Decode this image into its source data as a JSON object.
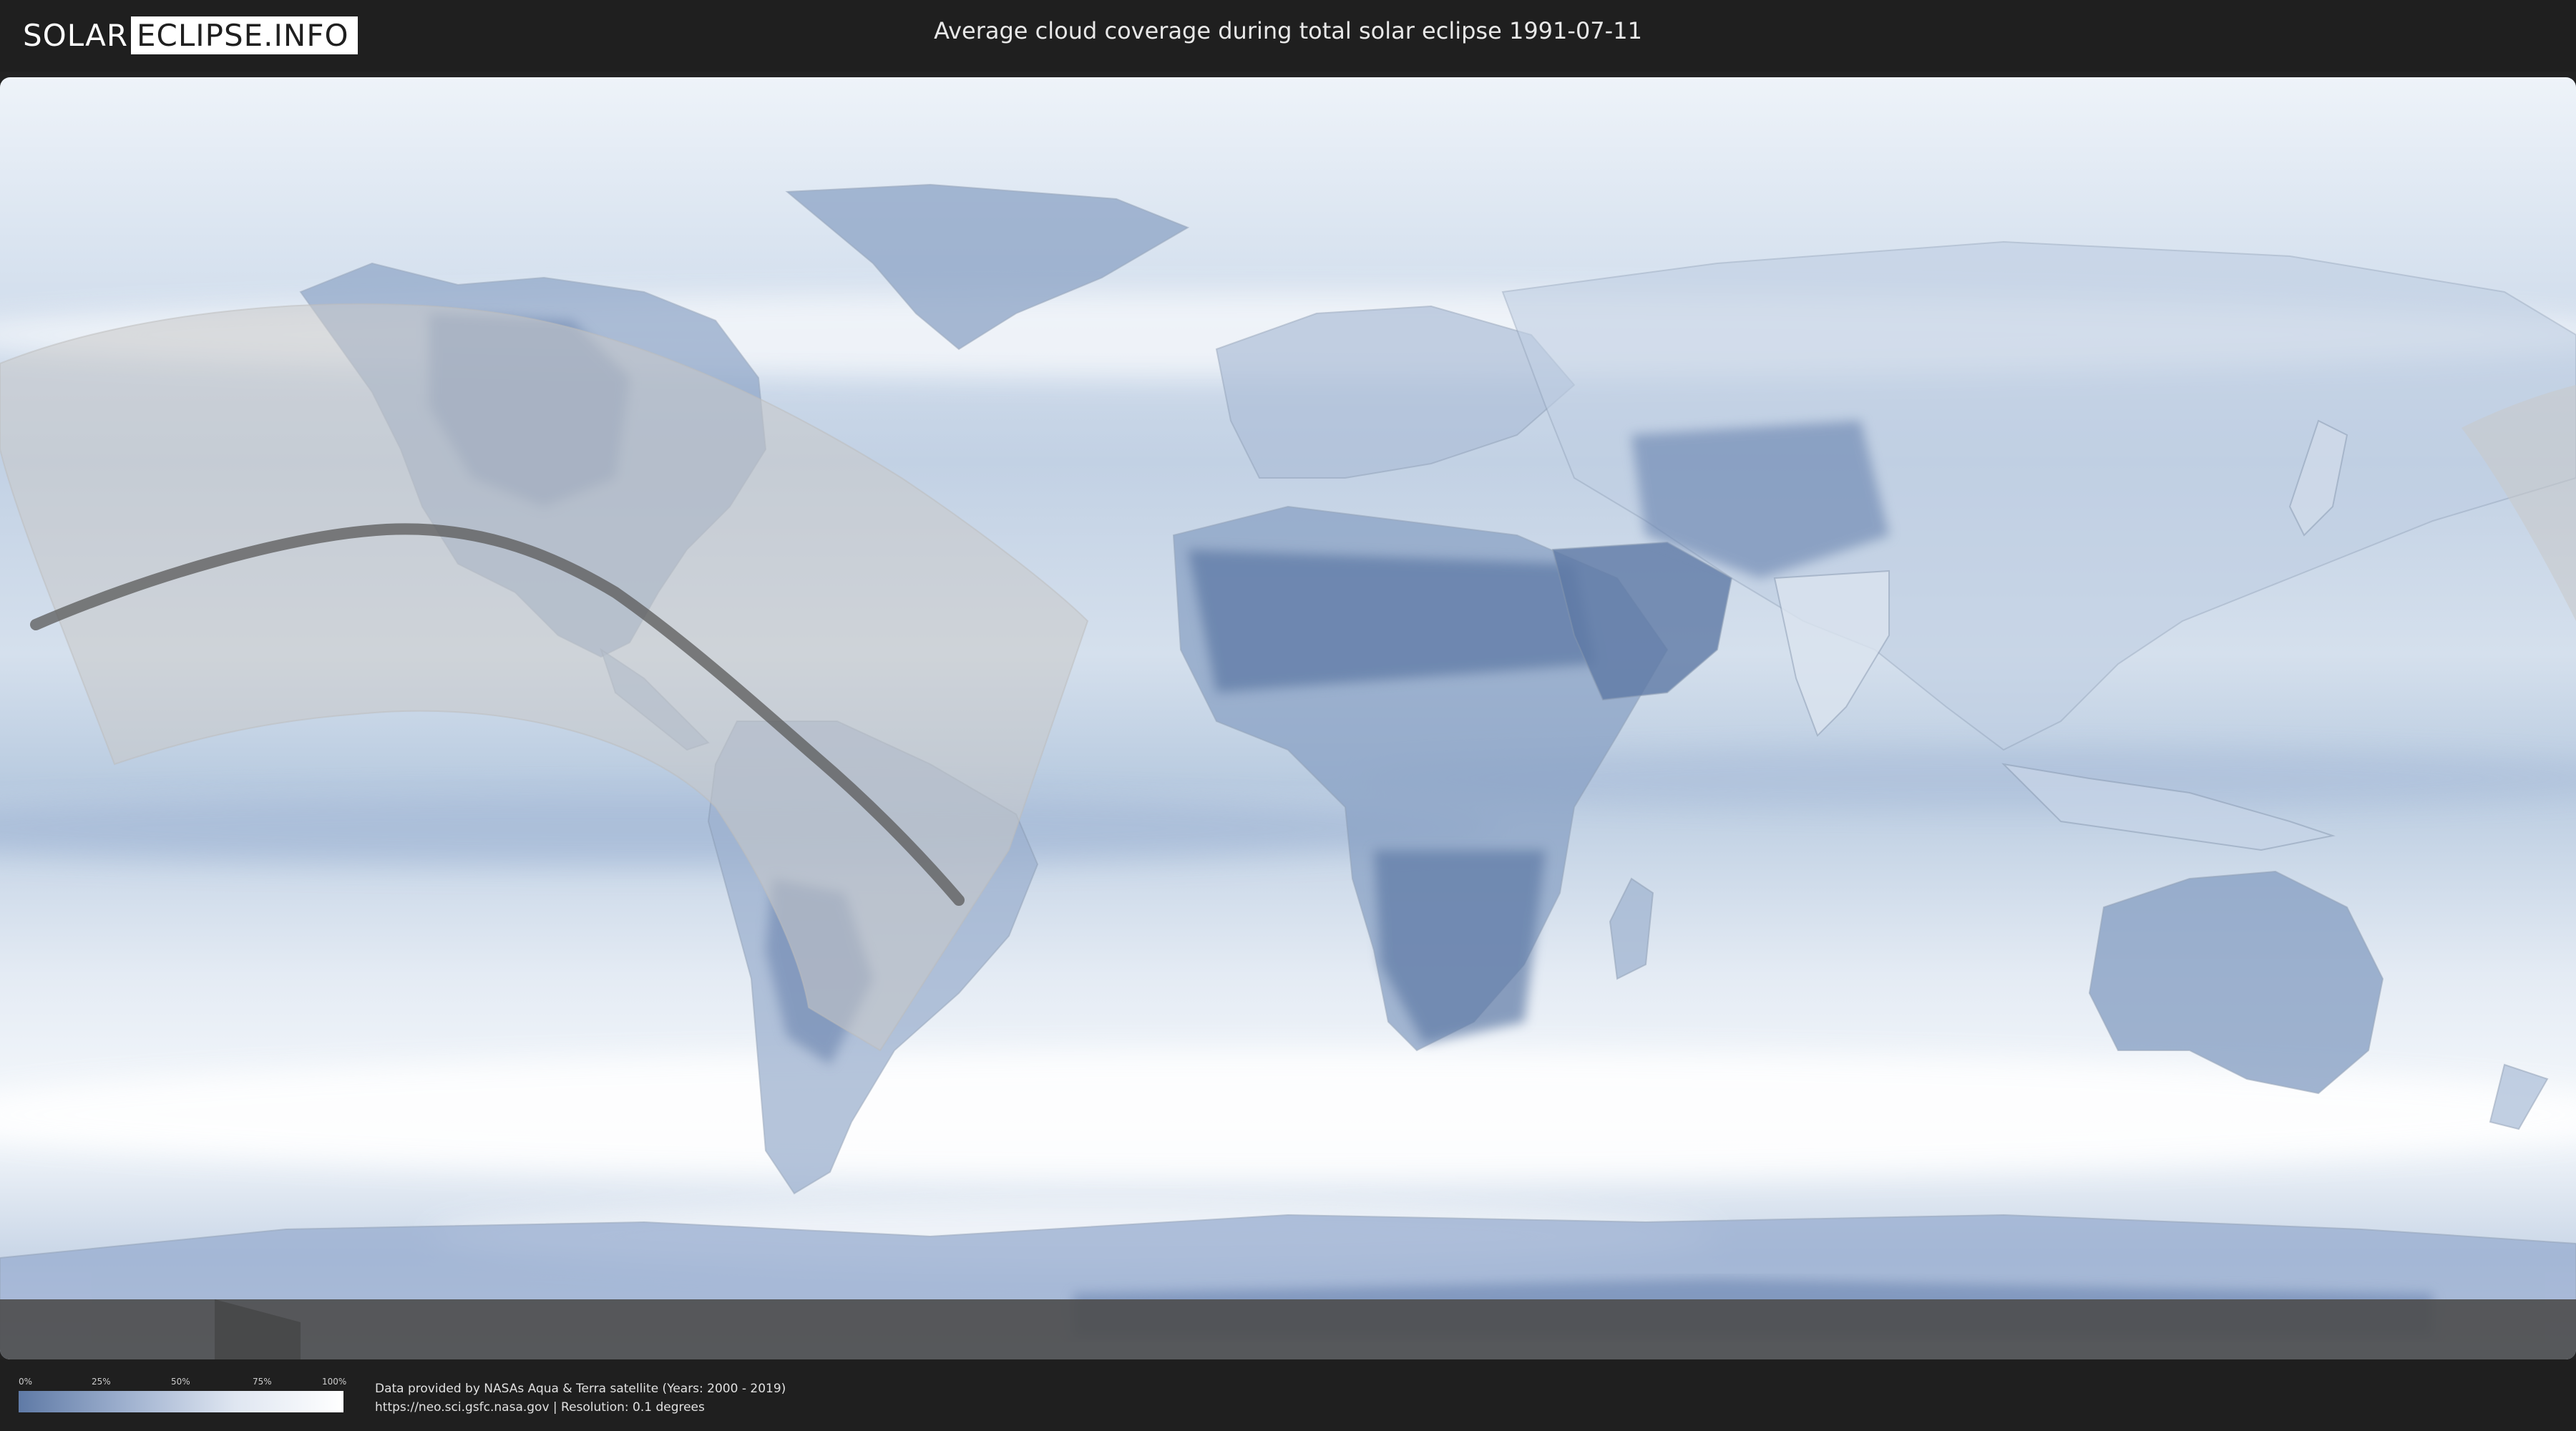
{
  "header": {
    "logo_left": "SOLAR",
    "logo_right": "ECLIPSE.INFO",
    "title": "Average cloud coverage during total solar eclipse 1991-07-11"
  },
  "legend": {
    "ticks": [
      "0%",
      "25%",
      "50%",
      "75%",
      "100%"
    ],
    "color_low": "#5f7aa6",
    "color_high": "#ffffff"
  },
  "footer": {
    "credit_line1": "Data provided by NASAs Aqua & Terra satellite (Years: 2000 - 2019)",
    "credit_line2": "https://neo.sci.gsfc.nasa.gov | Resolution: 0.1 degrees"
  },
  "colors": {
    "background": "#1f1f1f",
    "clear_sky": "#5f7aa6",
    "cloudy": "#ffffff",
    "path_band": "rgba(200,200,200,0.55)",
    "totality_line": "#555555"
  }
}
